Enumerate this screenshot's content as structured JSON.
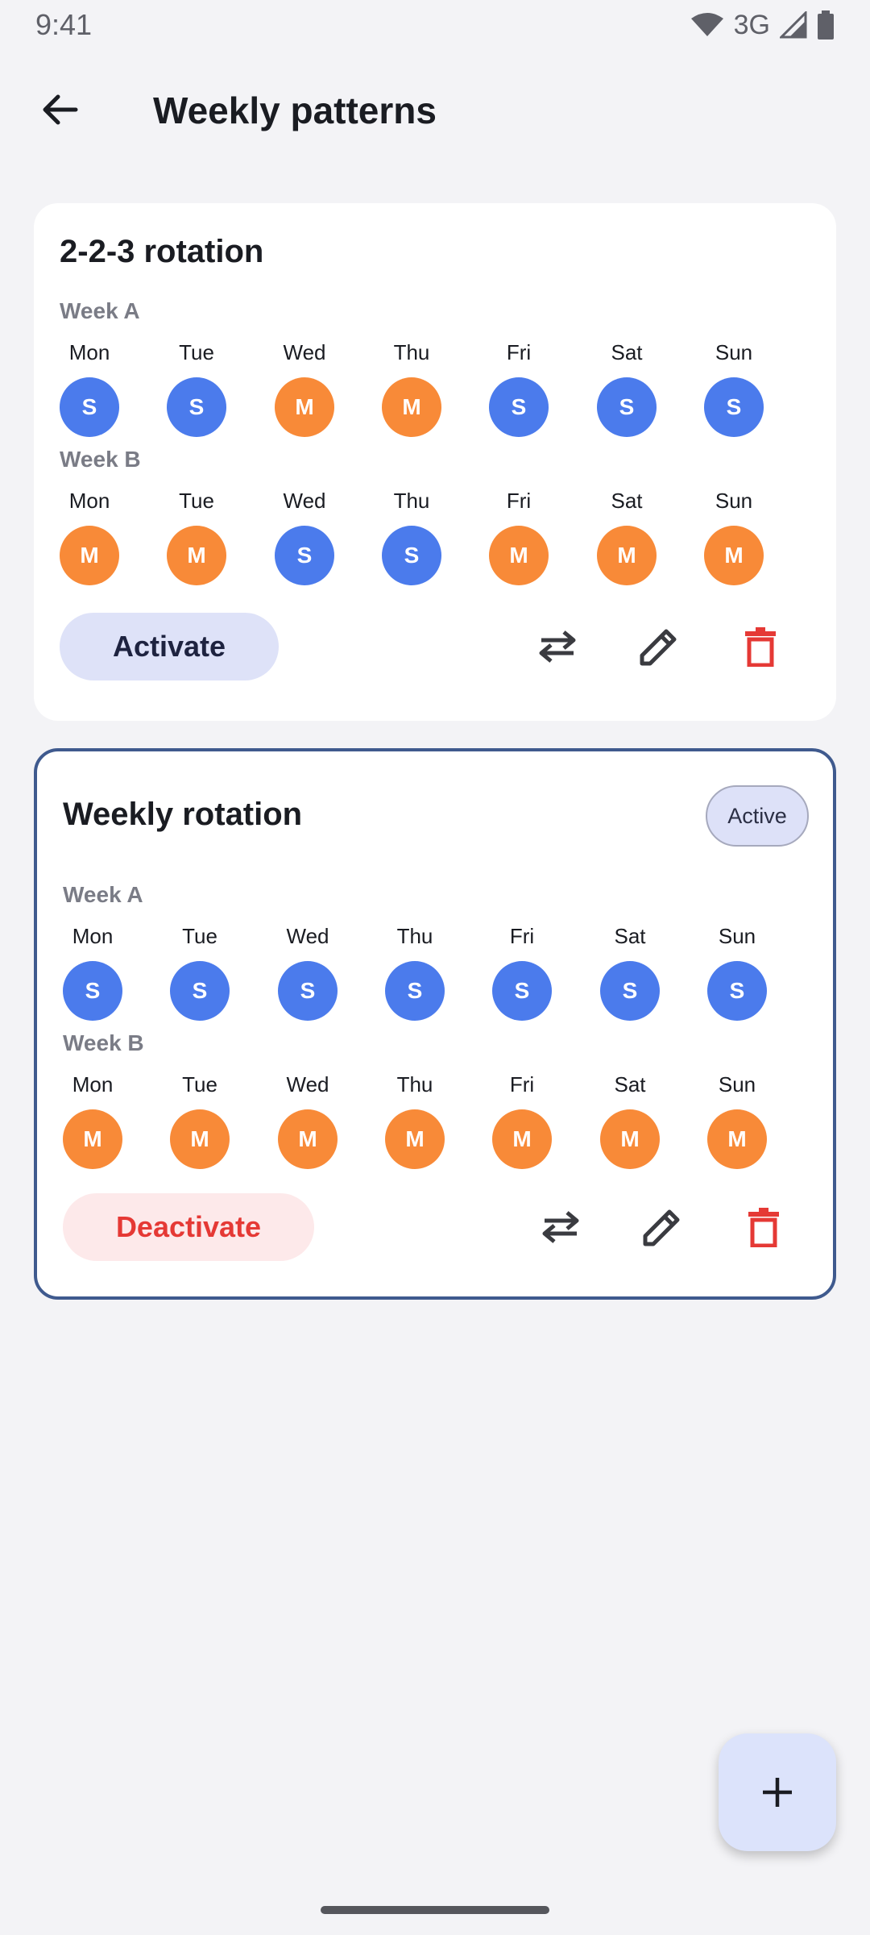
{
  "status_bar": {
    "time": "9:41",
    "network": "3G"
  },
  "app_bar": {
    "title": "Weekly patterns"
  },
  "colors": {
    "S": "#4b7bec",
    "M": "#f88a38",
    "active_border": "#3f5a8e",
    "danger": "#e53935"
  },
  "patterns": [
    {
      "name": "2-2-3 rotation",
      "active": false,
      "badge": "",
      "weeks": [
        {
          "label": "Week A",
          "days": [
            {
              "name": "Mon",
              "shift": "S"
            },
            {
              "name": "Tue",
              "shift": "S"
            },
            {
              "name": "Wed",
              "shift": "M"
            },
            {
              "name": "Thu",
              "shift": "M"
            },
            {
              "name": "Fri",
              "shift": "S"
            },
            {
              "name": "Sat",
              "shift": "S"
            },
            {
              "name": "Sun",
              "shift": "S"
            }
          ]
        },
        {
          "label": "Week B",
          "days": [
            {
              "name": "Mon",
              "shift": "M"
            },
            {
              "name": "Tue",
              "shift": "M"
            },
            {
              "name": "Wed",
              "shift": "S"
            },
            {
              "name": "Thu",
              "shift": "S"
            },
            {
              "name": "Fri",
              "shift": "M"
            },
            {
              "name": "Sat",
              "shift": "M"
            },
            {
              "name": "Sun",
              "shift": "M"
            }
          ]
        }
      ],
      "action_label": "Activate",
      "icons": [
        "swap-icon",
        "edit-icon",
        "delete-icon"
      ]
    },
    {
      "name": "Weekly rotation",
      "active": true,
      "badge": "Active",
      "weeks": [
        {
          "label": "Week A",
          "days": [
            {
              "name": "Mon",
              "shift": "S"
            },
            {
              "name": "Tue",
              "shift": "S"
            },
            {
              "name": "Wed",
              "shift": "S"
            },
            {
              "name": "Thu",
              "shift": "S"
            },
            {
              "name": "Fri",
              "shift": "S"
            },
            {
              "name": "Sat",
              "shift": "S"
            },
            {
              "name": "Sun",
              "shift": "S"
            }
          ]
        },
        {
          "label": "Week B",
          "days": [
            {
              "name": "Mon",
              "shift": "M"
            },
            {
              "name": "Tue",
              "shift": "M"
            },
            {
              "name": "Wed",
              "shift": "M"
            },
            {
              "name": "Thu",
              "shift": "M"
            },
            {
              "name": "Fri",
              "shift": "M"
            },
            {
              "name": "Sat",
              "shift": "M"
            },
            {
              "name": "Sun",
              "shift": "M"
            }
          ]
        }
      ],
      "action_label": "Deactivate",
      "icons": [
        "swap-icon",
        "edit-icon",
        "delete-icon"
      ]
    }
  ],
  "fab": {
    "icon": "plus-icon"
  }
}
